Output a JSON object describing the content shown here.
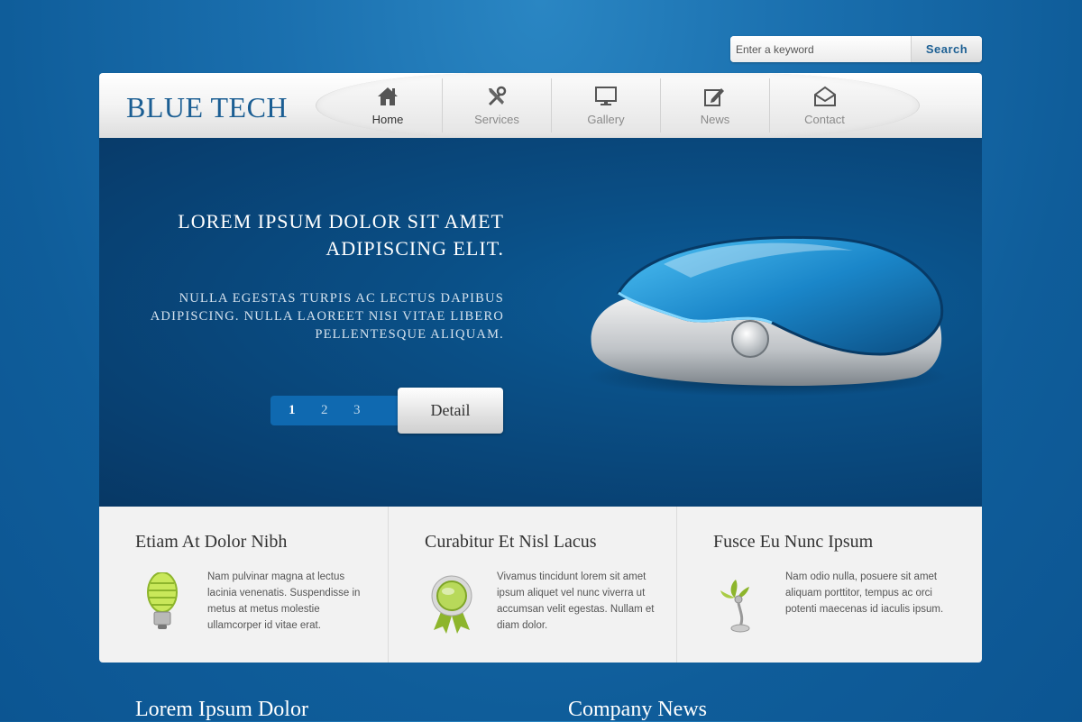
{
  "search": {
    "placeholder": "Enter a keyword",
    "button_label": "Search"
  },
  "header": {
    "logo": "BLUE TECH",
    "nav": [
      {
        "label": "Home",
        "icon": "home-icon",
        "active": true
      },
      {
        "label": "Services",
        "icon": "tools-icon",
        "active": false
      },
      {
        "label": "Gallery",
        "icon": "monitor-icon",
        "active": false
      },
      {
        "label": "News",
        "icon": "edit-icon",
        "active": false
      },
      {
        "label": "Contact",
        "icon": "envelope-icon",
        "active": false
      }
    ]
  },
  "hero": {
    "title": "LOREM IPSUM DOLOR SIT AMET ADIPISCING ELIT.",
    "subtitle": "NULLA EGESTAS TURPIS AC LECTUS DAPIBUS ADIPISCING. NULLA LAOREET NISI VITAE LIBERO PELLENTESQUE ALIQUAM.",
    "pages": [
      "1",
      "2",
      "3"
    ],
    "current_page": "1",
    "detail_label": "Detail",
    "image": "computer-mouse-illustration"
  },
  "features": [
    {
      "title": "Etiam At Dolor Nibh",
      "icon": "lightbulb-icon",
      "text": "Nam pulvinar magna at lectus lacinia venenatis. Suspendisse in metus at metus molestie ullamcorper id vitae erat."
    },
    {
      "title": "Curabitur Et Nisl Lacus",
      "icon": "award-badge-icon",
      "text": "Vivamus tincidunt lorem sit amet ipsum aliquet vel nunc viverra ut accumsan velit egestas. Nullam et diam dolor."
    },
    {
      "title": "Fusce Eu Nunc Ipsum",
      "icon": "plant-fan-icon",
      "text": "Nam odio nulla, posuere sit amet aliquam porttitor, tempus ac orci potenti maecenas id iaculis ipsum."
    }
  ],
  "bottom": {
    "left_heading": "Lorem Ipsum Dolor",
    "right_heading": "Company News"
  },
  "colors": {
    "accent": "#1b5e93",
    "hero_bg": "#0a4f86",
    "page_bg": "#1a6fae"
  }
}
